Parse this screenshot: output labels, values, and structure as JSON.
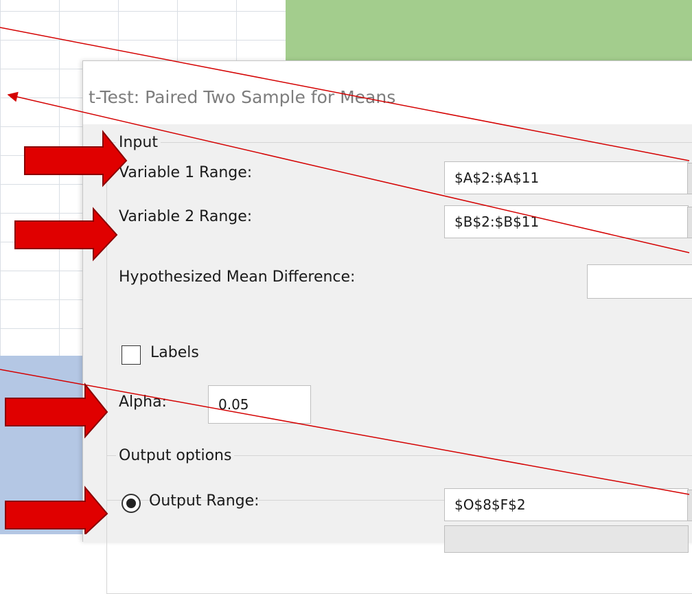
{
  "dialog": {
    "title": "t-Test: Paired Two Sample for Means",
    "input_group_label": "Input",
    "variable1": {
      "label": "Variable 1 Range:",
      "value": "$A$2:$A$11"
    },
    "variable2": {
      "label": "Variable 2 Range:",
      "value": "$B$2:$B$11"
    },
    "hypothesized": {
      "label": "Hypothesized Mean Difference:",
      "value": ""
    },
    "labels": {
      "label": "Labels",
      "checked": false
    },
    "alpha": {
      "label": "Alpha:",
      "value": "0.05"
    },
    "output_group_label": "Output options",
    "output_range": {
      "label": "Output Range:",
      "value": "$O$8$F$2",
      "selected": true
    }
  },
  "annotations": {
    "arrow_color": "#e00000",
    "line_color": "#d40000",
    "highlight_colors": {
      "green": "#a3cd8d",
      "blue": "#b4c7e4"
    }
  }
}
